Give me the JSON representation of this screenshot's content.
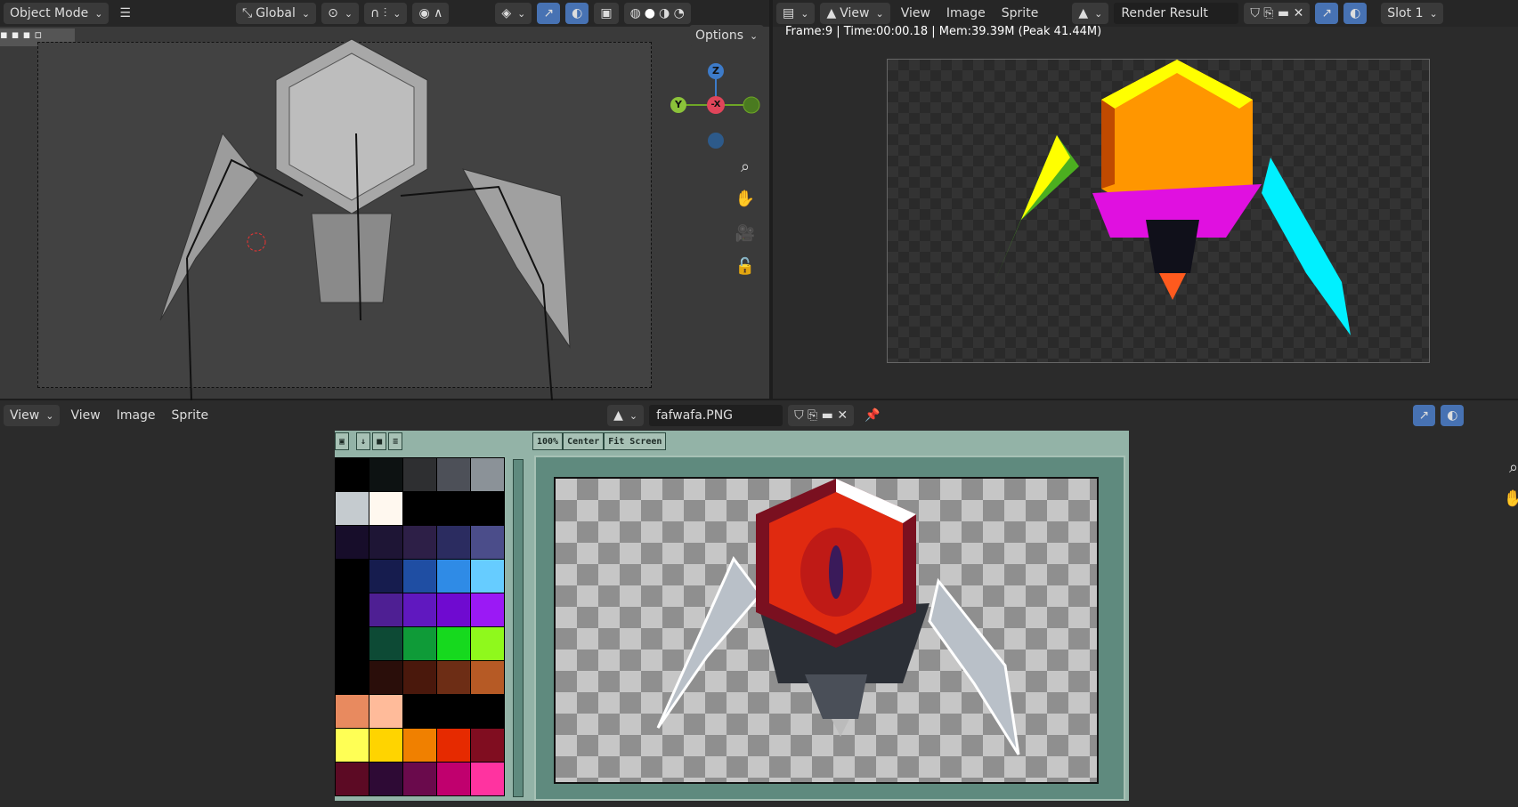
{
  "viewport3d": {
    "mode": "Object Mode",
    "transform_orientation": "Global",
    "options_label": "Options",
    "gizmo": {
      "z": "Z",
      "y": "Y",
      "x": "-X"
    }
  },
  "image_editor_top": {
    "view_dropdown": "View",
    "menu": [
      "View",
      "Image",
      "Sprite"
    ],
    "image_name": "Render Result",
    "slot": "Slot 1",
    "render_info": "Frame:9 | Time:00:00.18 | Mem:39.39M (Peak 41.44M)"
  },
  "image_editor_bottom": {
    "view_dropdown": "View",
    "menu": [
      "View",
      "Image",
      "Sprite"
    ],
    "image_name": "fafwafa.PNG"
  },
  "sprite_editor": {
    "buttons": [
      "100%",
      "Center",
      "Fit Screen"
    ],
    "palette": [
      "#000000",
      "#0d1212",
      "#2e2f31",
      "#4d5058",
      "#8b9298",
      "#c5cbcf",
      "#fff8ef",
      "#000000",
      "#000000",
      "#000000",
      "#170d2a",
      "#1e1535",
      "#2d1f47",
      "#2b2c60",
      "#4b4d8a",
      "#000000",
      "#161c4e",
      "#1f4ea3",
      "#2f8be6",
      "#66ccff",
      "#000000",
      "#4e1f93",
      "#6018bf",
      "#6f0ad0",
      "#9b19f5",
      "#000000",
      "#0d4a35",
      "#0f9b38",
      "#16d91e",
      "#8ff91c",
      "#000000",
      "#2a0e0a",
      "#4a180c",
      "#6d2d15",
      "#b65a25",
      "#e88a5f",
      "#ffbb9a",
      "#000000",
      "#000000",
      "#000000",
      "#ffff55",
      "#ffd400",
      "#f08000",
      "#e62a00",
      "#800d20",
      "#5c0a24",
      "#2e0a35",
      "#6a0a4c",
      "#c0006e",
      "#ff33a0"
    ]
  },
  "colors": {
    "accent": "#4772b3",
    "header": "#2b2b2b",
    "sprite_panel": "#93b3a7"
  }
}
